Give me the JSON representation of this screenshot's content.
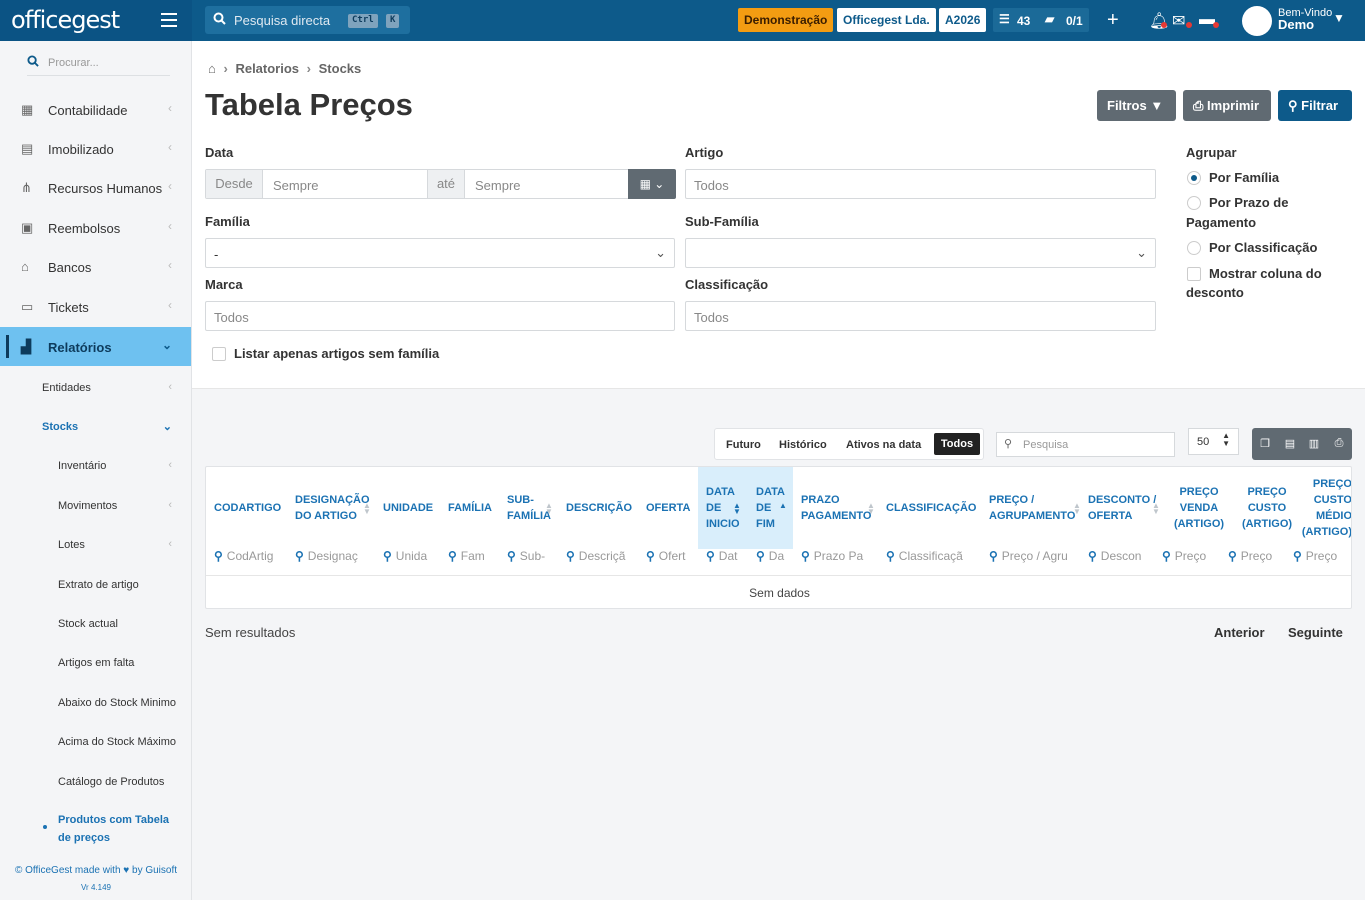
{
  "topbar": {
    "logo": "officegest",
    "search_placeholder": "Pesquisa directa",
    "kbd1": "Ctrl",
    "kbd2": "K",
    "demo": "Demonstração",
    "company": "Officegest Lda.",
    "year": "A2026",
    "tasks": "43",
    "docs": "0/1",
    "welcome": "Bem-Vindo",
    "user": "Demo"
  },
  "sidebar": {
    "search_placeholder": "Procurar...",
    "items": [
      {
        "label": "Contabilidade",
        "icon": "calculator-icon"
      },
      {
        "label": "Imobilizado",
        "icon": "boxes-icon"
      },
      {
        "label": "Recursos Humanos",
        "icon": "org-chart-icon"
      },
      {
        "label": "Reembolsos",
        "icon": "money-icon"
      },
      {
        "label": "Bancos",
        "icon": "bank-icon"
      },
      {
        "label": "Tickets",
        "icon": "ticket-icon"
      },
      {
        "label": "Relatórios",
        "icon": "chart-icon"
      }
    ],
    "sub": [
      "Entidades",
      "Stocks"
    ],
    "subsub": [
      "Inventário",
      "Movimentos",
      "Lotes",
      "Extrato de artigo",
      "Stock actual",
      "Artigos em falta",
      "Abaixo do Stock Minimo",
      "Acima do Stock Máximo",
      "Catálogo de Produtos",
      "Produtos com Tabela de preços"
    ],
    "footer": "© OfficeGest made with ♥ by Guisoft",
    "version": "Vr 4.149"
  },
  "breadcrumb": {
    "a": "Relatorios",
    "b": "Stocks"
  },
  "page": {
    "title": "Tabela Preços",
    "btn_filtros": "Filtros",
    "btn_imprimir": "Imprimir",
    "btn_filtrar": "Filtrar"
  },
  "form": {
    "data_label": "Data",
    "desde": "Desde",
    "ate": "até",
    "sempre": "Sempre",
    "artigo_label": "Artigo",
    "todos": "Todos",
    "familia_label": "Família",
    "familia_value": "-",
    "subfamilia_label": "Sub-Família",
    "marca_label": "Marca",
    "classificacao_label": "Classificação",
    "sem_familia": "Listar apenas artigos sem família"
  },
  "agrupar": {
    "label": "Agrupar",
    "opt1": "Por Família",
    "opt2": "Por Prazo de Pagamento",
    "opt3": "Por Classificação",
    "chk": "Mostrar coluna do desconto"
  },
  "table": {
    "tabs": [
      "Futuro",
      "Histórico",
      "Ativos na data",
      "Todos"
    ],
    "search_placeholder": "Pesquisa",
    "page_size": "50",
    "columns": [
      "CODARTIGO",
      "DESIGNAÇÃO DO ARTIGO",
      "UNIDADE",
      "FAMÍLIA",
      "SUB-FAMÍLIA",
      "DESCRIÇÃO",
      "OFERTA",
      "DATA DE INICIO",
      "DATA DE FIM",
      "PRAZO PAGAMENTO",
      "CLASSIFICAÇÃO",
      "PREÇO / AGRUPAMENTO",
      "DESCONTO / OFERTA",
      "PREÇO VENDA (ARTIGO)",
      "PREÇO CUSTO (ARTIGO)",
      "PREÇO CUSTO MÉDIO (ARTIGO)"
    ],
    "filters": [
      "CodArtig",
      "Designaç",
      "Unida",
      "Fam",
      "Sub-",
      "Descriçã",
      "Ofert",
      "Dat",
      "Da",
      "Prazo Pa",
      "Classificaçã",
      "Preço / Agru",
      "Descon",
      "Preço",
      "Preço",
      "Preço"
    ],
    "no_data": "Sem dados",
    "no_results": "Sem resultados",
    "prev": "Anterior",
    "next": "Seguinte"
  }
}
